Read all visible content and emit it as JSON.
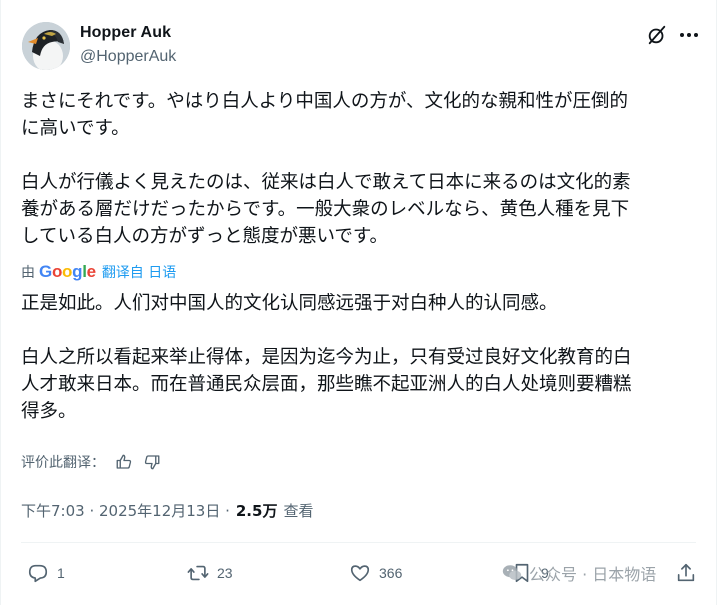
{
  "user": {
    "display_name": "Hopper Auk",
    "handle": "@HopperAuk"
  },
  "icons": {
    "grok": "grok-icon",
    "more": "more-icon"
  },
  "post": {
    "original_text": "まさにそれです。やはり白人より中国人の方が、文化的な親和性が圧倒的\nに高いです。\n\n白人が行儀よく見えたのは、従来は白人で敢えて日本に来るのは文化的素\n養がある層だけだったからです。一般大衆のレベルなら、黄色人種を見下\nしている白人の方がずっと態度が悪いです。",
    "translated_by_prefix": "由",
    "google_label": "Google",
    "translate_link": "翻译自 日语",
    "translated_text": "正是如此。人们对中国人的文化认同感远强于对白种人的认同感。\n\n白人之所以看起来举止得体，是因为迄今为止，只有受过良好文化教育的白\n人才敢来日本。而在普通民众层面，那些瞧不起亚洲人的白人处境则要糟糕\n得多。",
    "rate_label": "评价此翻译："
  },
  "meta": {
    "time": "下午7:03 · 2025年12月13日 ·",
    "views_count": "2.5万",
    "views_label": "查看"
  },
  "actions": {
    "reply_count": "1",
    "repost_count": "23",
    "like_count": "366",
    "bookmark_count": "9"
  },
  "watermark": {
    "text": "公众号 · 日本物语"
  },
  "colors": {
    "text": "#0f1419",
    "secondary": "#536471",
    "link": "#1d9bf0",
    "divider": "#eff3f4"
  }
}
